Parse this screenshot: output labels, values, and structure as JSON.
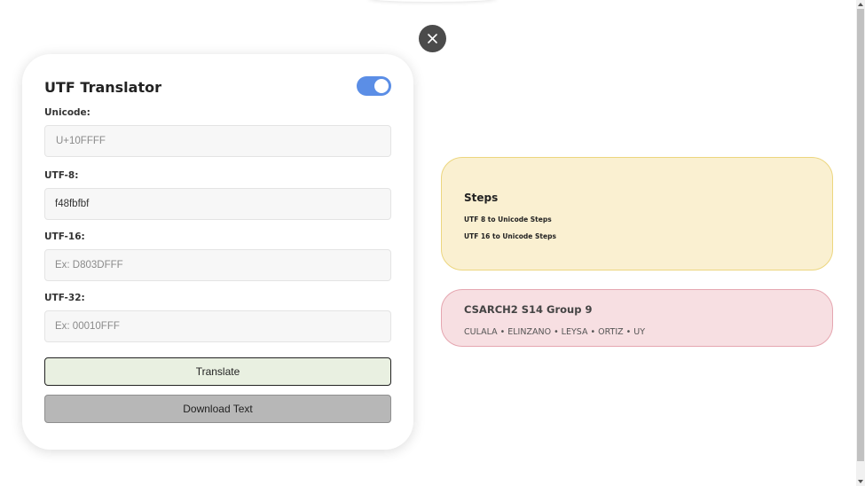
{
  "close_button": {
    "icon": "close-icon"
  },
  "translator": {
    "title": "UTF Translator",
    "toggle_on": true,
    "fields": {
      "unicode": {
        "label": "Unicode:",
        "value": "",
        "placeholder": "U+10FFFF"
      },
      "utf8": {
        "label": "UTF-8:",
        "value": "f48fbfbf",
        "placeholder": ""
      },
      "utf16": {
        "label": "UTF-16:",
        "value": "",
        "placeholder": "Ex: D803DFFF"
      },
      "utf32": {
        "label": "UTF-32:",
        "value": "",
        "placeholder": "Ex: 00010FFF"
      }
    },
    "translate_label": "Translate",
    "download_label": "Download Text"
  },
  "steps": {
    "title": "Steps",
    "links": [
      "UTF 8 to Unicode Steps",
      "UTF 16 to Unicode Steps"
    ]
  },
  "group": {
    "title": "CSARCH2 S14 Group 9",
    "members": "CULALA • ELINZANO • LEYSA • ORTIZ • UY"
  },
  "colors": {
    "toggle": "#5b8ee6",
    "steps_bg": "#faf0d1",
    "steps_border": "#ecd67f",
    "group_bg": "#f7dfe2",
    "group_border": "#e5a6b0",
    "translate_bg": "#e9f0e1",
    "download_bg": "#b7b7b7"
  }
}
